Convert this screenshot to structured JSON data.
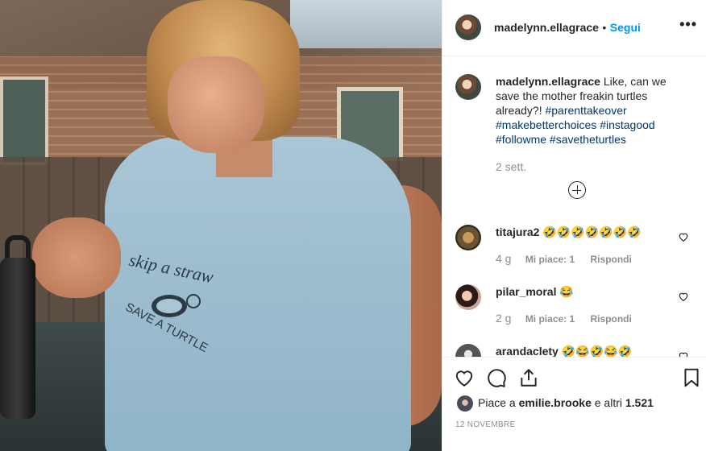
{
  "post": {
    "username": "madelynn.ellagrace",
    "separator": "•",
    "follow_label": "Segui",
    "more_label": "•••",
    "caption_text": "Like, can we save the mother freakin turtles already?!",
    "hashtags": [
      "#parenttakeover",
      "#makebetterchoices",
      "#instagood",
      "#followme",
      "#savetheturtles"
    ],
    "time_ago": "2 sett.",
    "shirt_print_top": "skip a straw",
    "shirt_print_bottom": "SAVE A TURTLE"
  },
  "comments": [
    {
      "username": "titajura2",
      "text": "🤣🤣🤣🤣🤣🤣🤣",
      "age": "4 g",
      "likes": "Mi piace: 1",
      "reply": "Rispondi"
    },
    {
      "username": "pilar_moral",
      "text": "😂",
      "age": "2 g",
      "likes": "Mi piace: 1",
      "reply": "Rispondi"
    },
    {
      "username": "arandaclety",
      "text": "🤣😂🤣😂🤣"
    }
  ],
  "footer": {
    "liked_prefix": "Piace a",
    "liked_user": "emilie.brooke",
    "liked_connector": "e altri",
    "liked_count": "1.521",
    "date": "12 NOVEMBRE"
  },
  "icons": [
    "more-options-icon",
    "plus-circle-icon",
    "heart-icon",
    "comment-icon",
    "share-icon",
    "bookmark-icon"
  ],
  "colors": {
    "accent": "#0095f6",
    "hashtag": "#00376b",
    "muted": "#8e8e8e",
    "text": "#262626"
  }
}
